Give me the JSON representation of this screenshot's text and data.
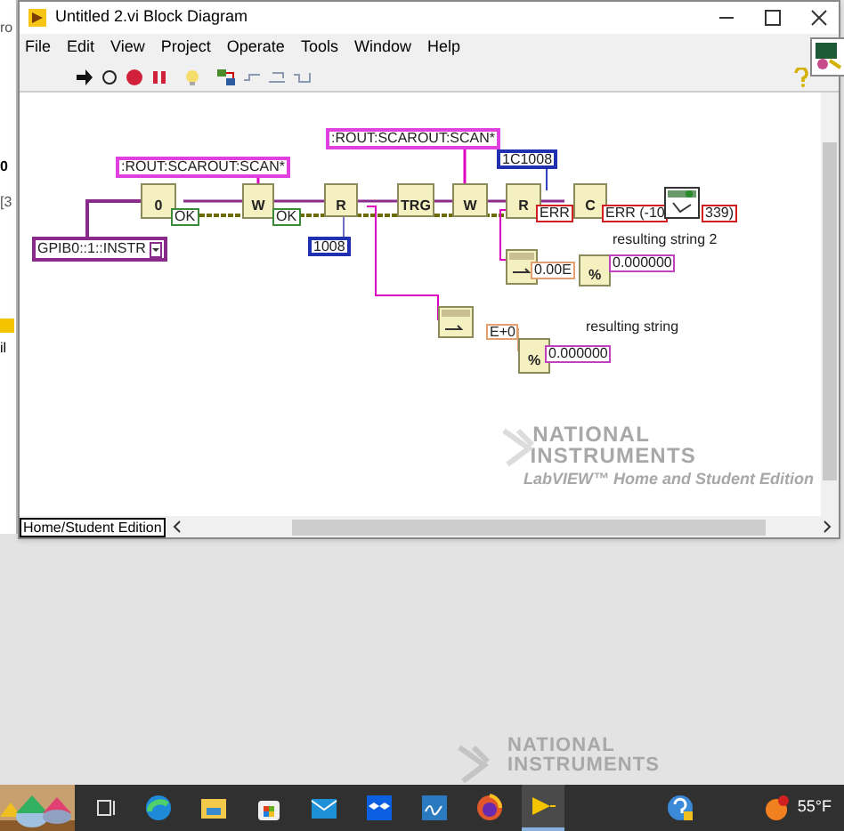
{
  "background_window": {
    "texts": [
      "ro",
      "0",
      "[3",
      "il"
    ]
  },
  "window": {
    "title": "Untitled 2.vi Block Diagram"
  },
  "menu": [
    "File",
    "Edit",
    "View",
    "Project",
    "Operate",
    "Tools",
    "Window",
    "Help"
  ],
  "diagram": {
    "nodes": [
      {
        "kind": "string_constant",
        "text": ":ROUT:SCAROUT:SCAN*"
      },
      {
        "kind": "string_constant",
        "text": ":ROUT:SCAROUT:SCAN*"
      },
      {
        "kind": "resource_constant",
        "text": "GPIB0::1::INSTR"
      },
      {
        "kind": "function",
        "text": "0"
      },
      {
        "kind": "ok_indicator",
        "text": "OK"
      },
      {
        "kind": "function",
        "text": "W"
      },
      {
        "kind": "ok_indicator",
        "text": "OK"
      },
      {
        "kind": "function",
        "text": "R"
      },
      {
        "kind": "numeric_constant",
        "text": "1008"
      },
      {
        "kind": "function",
        "text": "TRG"
      },
      {
        "kind": "function",
        "text": "W"
      },
      {
        "kind": "numeric_constant",
        "text": "1C1008"
      },
      {
        "kind": "function",
        "text": "R"
      },
      {
        "kind": "error_indicator",
        "text": "ERR"
      },
      {
        "kind": "function",
        "text": "C"
      },
      {
        "kind": "error_indicator",
        "text": "ERR (-10"
      },
      {
        "kind": "error_indicator",
        "text": "339)"
      },
      {
        "kind": "dialog_function"
      },
      {
        "kind": "label",
        "text": "resulting string 2"
      },
      {
        "kind": "scan_function"
      },
      {
        "kind": "numeric_indicator",
        "text": "0.00E"
      },
      {
        "kind": "function",
        "text": "%"
      },
      {
        "kind": "string_indicator",
        "text": "0.000000"
      },
      {
        "kind": "scan_function"
      },
      {
        "kind": "numeric_indicator",
        "text": "E+0"
      },
      {
        "kind": "label",
        "text": "resulting string"
      },
      {
        "kind": "function",
        "text": "%"
      },
      {
        "kind": "string_indicator",
        "text": "0.000000"
      }
    ]
  },
  "watermark": {
    "lines": [
      "NATIONAL",
      "INSTRUMENTS",
      "LabVIEW™ Home and Student Edition"
    ]
  },
  "context_tab": "Home/Student Edition",
  "desktop_watermark": {
    "lines": [
      "NATIONAL",
      "INSTRUMENTS"
    ]
  },
  "taskbar": {
    "temperature": "55°F"
  }
}
